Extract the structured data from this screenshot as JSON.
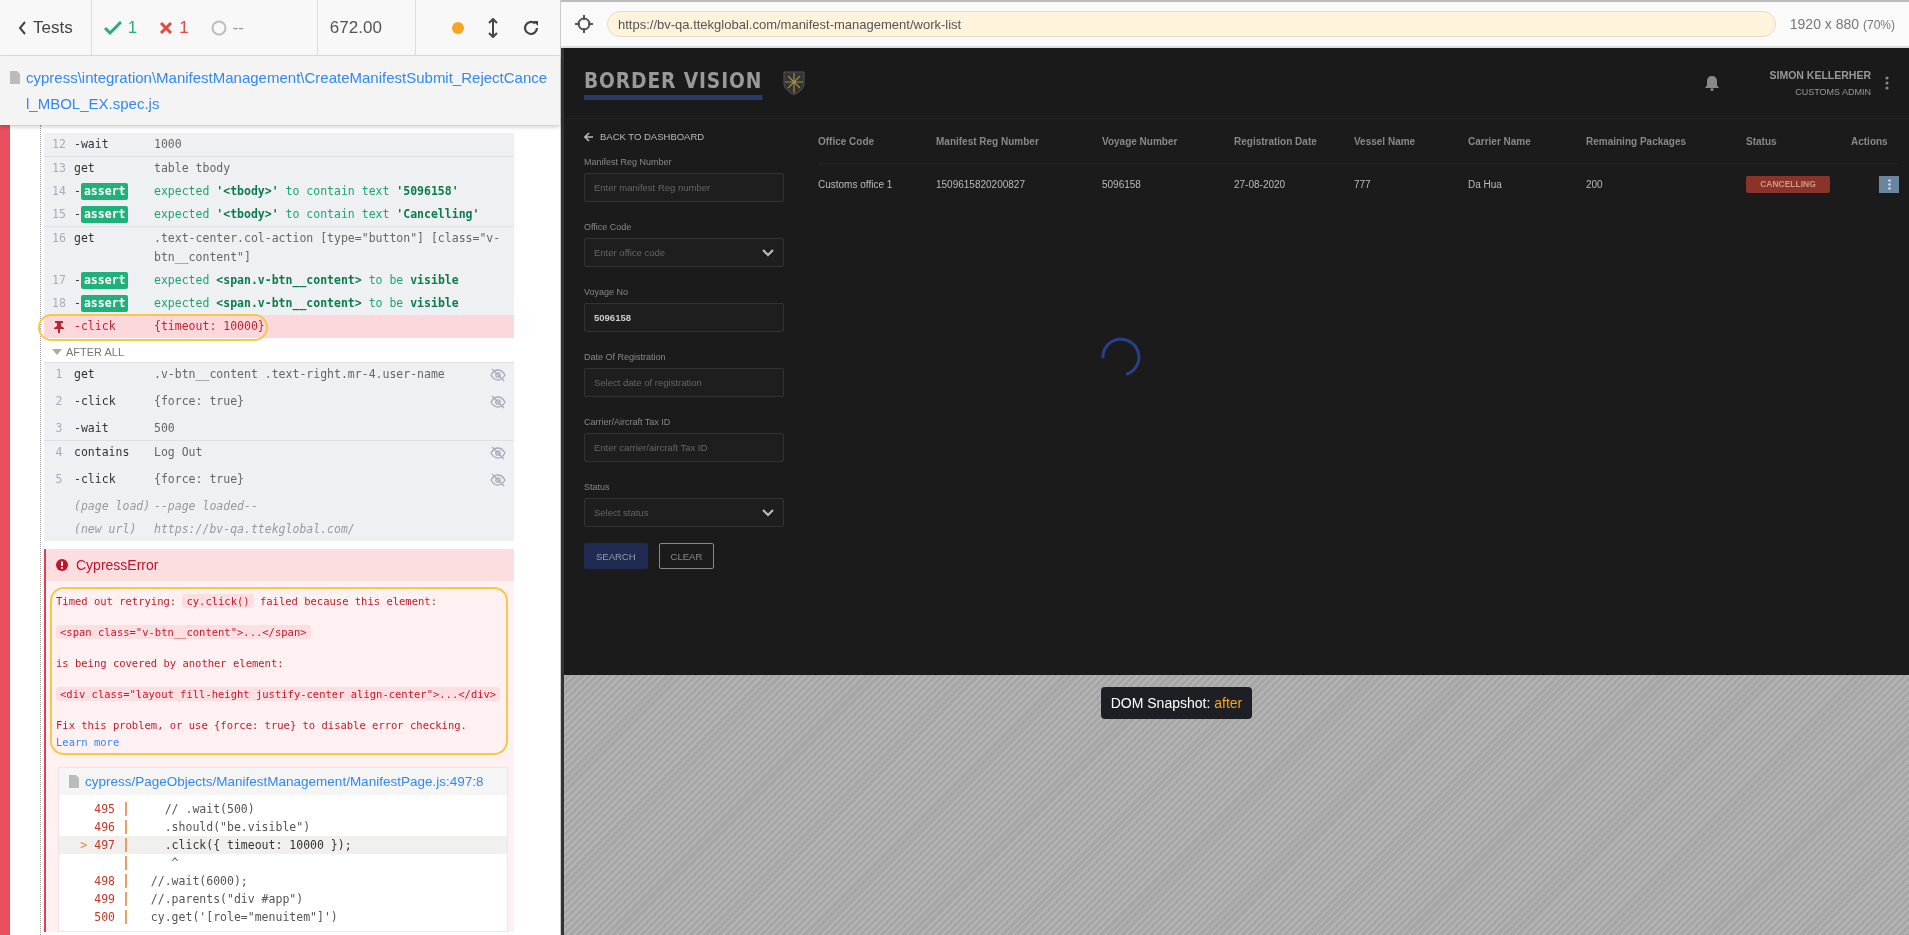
{
  "reporter": {
    "back_label": "Tests",
    "passed": "1",
    "failed": "1",
    "pending": "--",
    "duration": "672.00"
  },
  "spec_path": "cypress\\integration\\ManifestManagement\\CreateManifestSubmit_RejectCancel_MBOL_EX.spec.js",
  "commands": [
    {
      "number": "12",
      "prefix": "-",
      "name": "wait",
      "message": "1000",
      "kind": "child",
      "hidden": false
    },
    {
      "number": "13",
      "name": "get",
      "message": "table tbody",
      "kind": "parent",
      "hidden": false
    },
    {
      "number": "14",
      "prefix": "-",
      "name": "assert",
      "message": "expected **'<tbody>'** to contain text **'5096158'**",
      "kind": "assert",
      "hidden": false
    },
    {
      "number": "15",
      "prefix": "-",
      "name": "assert",
      "message": "expected **'<tbody>'** to contain text **'Cancelling'**",
      "kind": "assert",
      "hidden": false
    },
    {
      "number": "16",
      "name": "get",
      "message": ".text-center.col-action [type=\"button\"] [class=\"v-btn__content\"]",
      "kind": "parent",
      "hidden": false
    },
    {
      "number": "17",
      "prefix": "-",
      "name": "assert",
      "message": "expected **<span.v-btn__content>** to be **visible**",
      "kind": "assert",
      "hidden": false
    },
    {
      "number": "18",
      "prefix": "-",
      "name": "assert",
      "message": "expected **<span.v-btn__content>** to be **visible**",
      "kind": "assert",
      "hidden": false
    },
    {
      "prefix": "-",
      "name": "click",
      "message": "{timeout: 10000}",
      "kind": "failed",
      "hidden": false
    }
  ],
  "after_all": {
    "title": "AFTER ALL",
    "expanded": true,
    "commands": [
      {
        "number": "1",
        "name": "get",
        "message": ".v-btn__content .text-right.mr-4.user-name",
        "kind": "parent",
        "hidden": true
      },
      {
        "number": "2",
        "prefix": "-",
        "name": "click",
        "message": "{force: true}",
        "kind": "child",
        "hidden": true
      },
      {
        "number": "3",
        "prefix": "-",
        "name": "wait",
        "message": "500",
        "kind": "child",
        "hidden": false
      },
      {
        "number": "4",
        "name": "contains",
        "message": "Log Out",
        "kind": "parent",
        "hidden": true
      },
      {
        "number": "5",
        "prefix": "-",
        "name": "click",
        "message": "{force: true}",
        "kind": "child",
        "hidden": true
      },
      {
        "name": "(page load)",
        "message": "--page loaded--",
        "kind": "info",
        "hidden": false
      },
      {
        "name": "(new url)",
        "message": "https://bv-qa.ttekglobal.com/",
        "kind": "info",
        "hidden": false
      }
    ]
  },
  "error": {
    "title": "CypressError",
    "paragraphs": [
      [
        {
          "kind": "text",
          "text": "Timed out retrying: "
        },
        {
          "kind": "code",
          "text": "cy.click()"
        },
        {
          "kind": "text",
          "text": " failed because this element:"
        }
      ],
      [
        {
          "kind": "code",
          "text": "<span class=\"v-btn__content\">...</span>"
        }
      ],
      [
        {
          "kind": "text",
          "text": "is being covered by another element:"
        }
      ],
      [
        {
          "kind": "code",
          "text": "<div class=\"layout fill-height justify-center align-center\">...</div>"
        }
      ],
      [
        {
          "kind": "text",
          "text": "Fix this problem, or use {force: true} to disable error checking. "
        },
        {
          "kind": "link",
          "text": "Learn more"
        }
      ]
    ],
    "code_frame": {
      "file": "cypress/PageObjects/ManifestManagement/ManifestPage.js:497:8",
      "lines": [
        {
          "number": "495",
          "code": "    // .wait(500)",
          "current": false
        },
        {
          "number": "496",
          "code": "    .should(\"be.visible\")",
          "current": false
        },
        {
          "marker": ">",
          "number": "497",
          "code": "    .click({ timeout: 10000 });",
          "current": true
        },
        {
          "code": "     ^",
          "current": false
        },
        {
          "number": "498",
          "code": "  //.wait(6000);",
          "current": false
        },
        {
          "number": "499",
          "code": "  //.parents(\"div #app\")",
          "current": false
        },
        {
          "number": "500",
          "code": "  cy.get('[role=\"menuitem\"]')",
          "current": false
        }
      ]
    }
  },
  "browser": {
    "url": "https://bv-qa.ttekglobal.com/manifest-management/work-list",
    "viewport": "1920 x 880",
    "zoom": "(70%)"
  },
  "app": {
    "logo": "BORDER VISION",
    "user_name": "SIMON KELLERHER",
    "user_role": "CUSTOMS ADMIN",
    "back_link": "BACK TO DASHBOARD",
    "filters": [
      {
        "label": "Manifest Reg Number",
        "kind": "input",
        "placeholder": "Enter manifest Reg number"
      },
      {
        "label": "Office Code",
        "kind": "select",
        "placeholder": "Enter office code"
      },
      {
        "label": "Voyage No",
        "kind": "input",
        "value": "5096158"
      },
      {
        "label": "Date Of Registration",
        "kind": "input",
        "placeholder": "Select date of registration"
      },
      {
        "label": "Carrier/Aircraft Tax ID",
        "kind": "input",
        "placeholder": "Enter carrier/aircraft Tax ID"
      },
      {
        "label": "Status",
        "kind": "select",
        "placeholder": "Select status"
      }
    ],
    "buttons": [
      {
        "label": "SEARCH",
        "kind": "primary"
      },
      {
        "label": "CLEAR",
        "kind": "outline"
      }
    ],
    "table": {
      "columns": [
        "Office Code",
        "Manifest Reg Number",
        "Voyage Number",
        "Registration Date",
        "Vessel Name",
        "Carrier Name",
        "Remaining Packages",
        "Status",
        "Actions"
      ],
      "rows": [
        {
          "cells": [
            "Customs office 1",
            "1509615820200827",
            "5096158",
            "27-08-2020",
            "777",
            "Da Hua",
            "200"
          ],
          "status": "CANCELLING"
        }
      ]
    }
  },
  "snapshot": {
    "label": "DOM Snapshot:",
    "state": "after"
  }
}
